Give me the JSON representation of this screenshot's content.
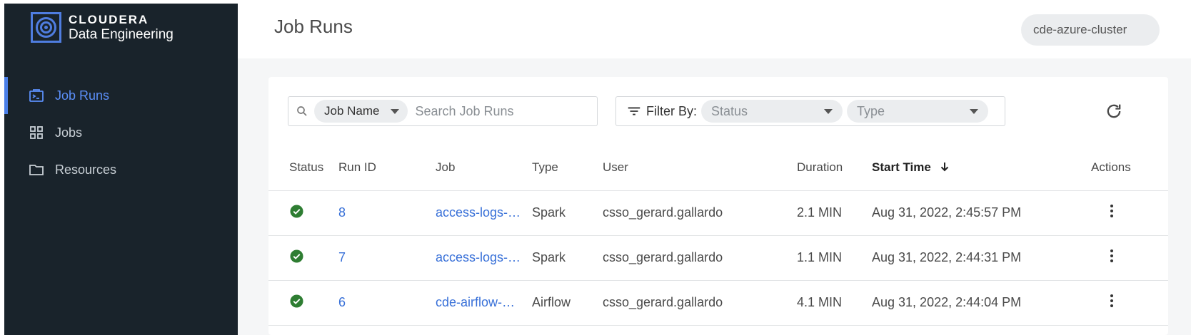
{
  "brand": {
    "name": "CLOUDERA",
    "product": "Data Engineering"
  },
  "nav": [
    {
      "label": "Job Runs",
      "active": true
    },
    {
      "label": "Jobs",
      "active": false
    },
    {
      "label": "Resources",
      "active": false
    }
  ],
  "header": {
    "title": "Job Runs",
    "cluster": "cde-azure-cluster"
  },
  "search": {
    "field": "Job Name",
    "placeholder": "Search Job Runs"
  },
  "filters": {
    "label": "Filter By:",
    "status_placeholder": "Status",
    "type_placeholder": "Type"
  },
  "table": {
    "columns": [
      "Status",
      "Run ID",
      "Job",
      "Type",
      "User",
      "Duration",
      "Start Time",
      "Actions"
    ],
    "sorted_column": "Start Time",
    "rows": [
      {
        "status": "success",
        "run_id": "8",
        "job": "access-logs-…",
        "type": "Spark",
        "user": "csso_gerard.gallardo",
        "duration": "2.1 MIN",
        "start_time": "Aug 31, 2022, 2:45:57 PM"
      },
      {
        "status": "success",
        "run_id": "7",
        "job": "access-logs-…",
        "type": "Spark",
        "user": "csso_gerard.gallardo",
        "duration": "1.1 MIN",
        "start_time": "Aug 31, 2022, 2:44:31 PM"
      },
      {
        "status": "success",
        "run_id": "6",
        "job": "cde-airflow-…",
        "type": "Airflow",
        "user": "csso_gerard.gallardo",
        "duration": "4.1 MIN",
        "start_time": "Aug 31, 2022, 2:44:04 PM"
      }
    ]
  },
  "colors": {
    "sidebar_bg": "#19232b",
    "accent": "#4a7fe8",
    "success": "#2e7d32",
    "link": "#3870d8"
  }
}
